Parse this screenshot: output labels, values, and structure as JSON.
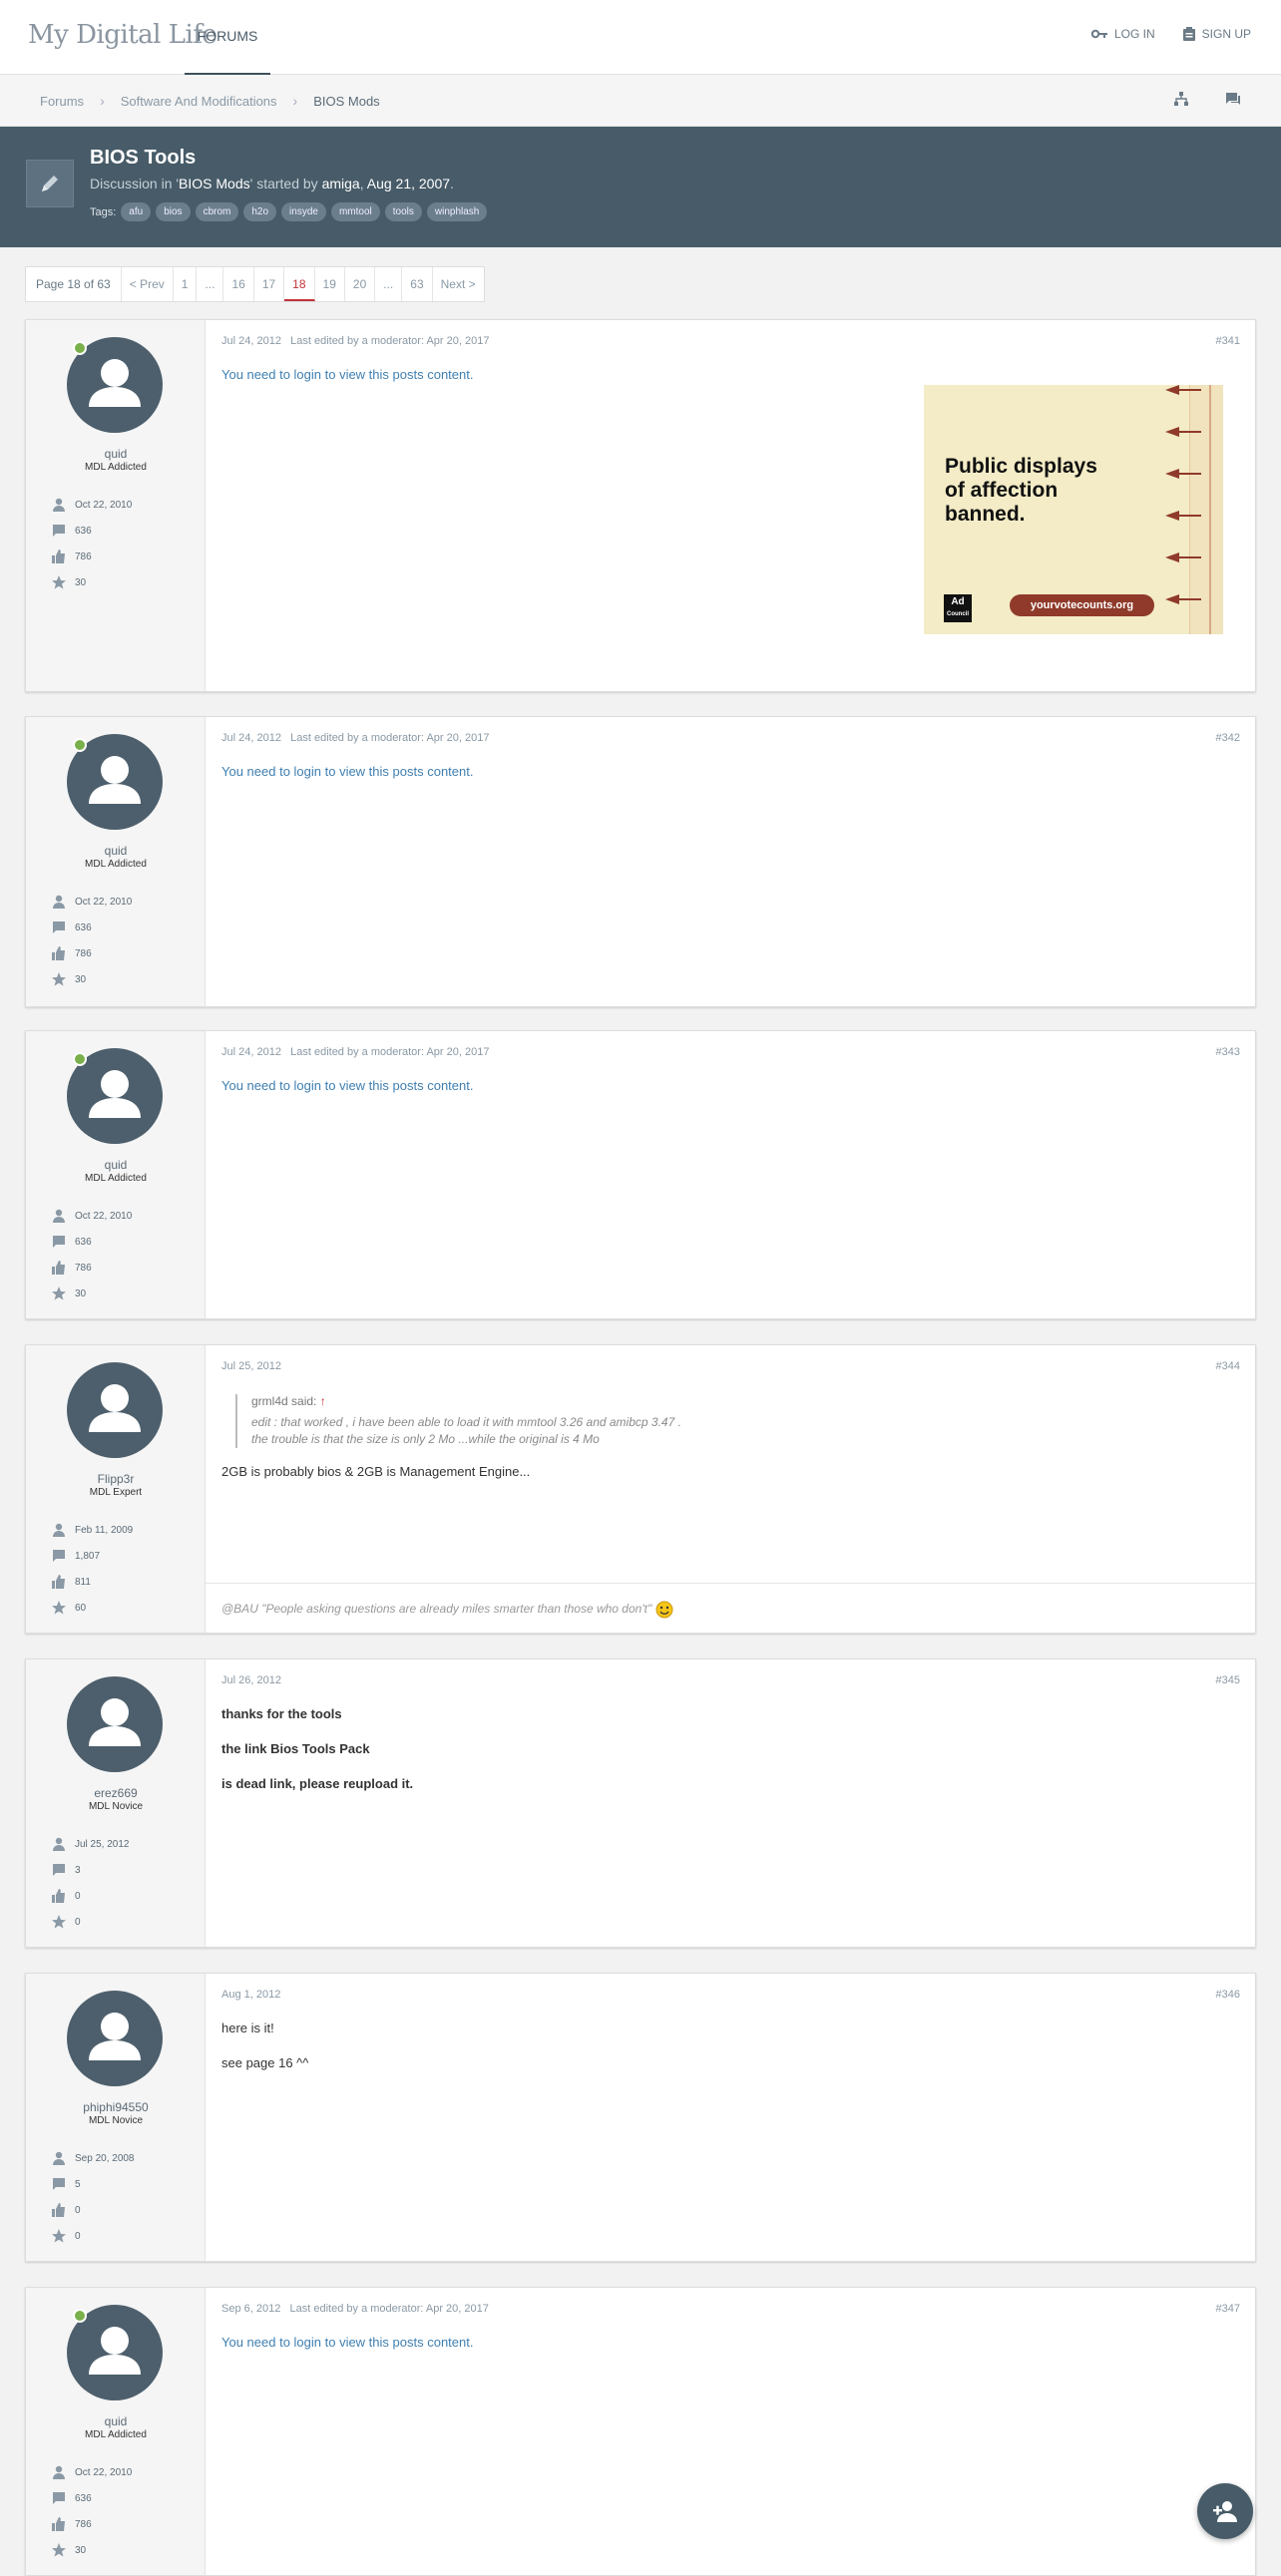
{
  "header": {
    "logo_main": "My Digital Life",
    "nav_forums": "FORUMS",
    "login": "LOG IN",
    "signup": "SIGN UP"
  },
  "breadcrumb": [
    "Forums",
    "Software And Modifications",
    "BIOS Mods"
  ],
  "thread": {
    "title": "BIOS Tools",
    "discussion_prefix": "Discussion in '",
    "forum": "BIOS Mods",
    "started_by": "' started by ",
    "author": "amiga",
    "date": "Aug 21, 2007",
    "tags_label": "Tags:",
    "tags": [
      "afu",
      "bios",
      "cbrom",
      "h2o",
      "insyde",
      "mmtool",
      "tools",
      "winphlash"
    ]
  },
  "pager": {
    "label": "Page 18 of 63",
    "prev": "< Prev",
    "pages": [
      "1",
      "...",
      "16",
      "17",
      "18",
      "19",
      "20",
      "...",
      "63"
    ],
    "active": "18",
    "next": "Next >"
  },
  "posts": [
    {
      "user": "quid",
      "rank": "MDL Addicted",
      "joined": "Oct 22, 2010",
      "messages": "636",
      "likes": "786",
      "points": "30",
      "date": "Jul 24, 2012",
      "edited": "Last edited by a moderator: Apr 20, 2017",
      "num": "#341",
      "text": "You need to login to view this posts content."
    },
    {
      "user": "quid",
      "rank": "MDL Addicted",
      "joined": "Oct 22, 2010",
      "messages": "636",
      "likes": "786",
      "points": "30",
      "date": "Jul 24, 2012",
      "edited": "Last edited by a moderator: Apr 20, 2017",
      "num": "#342",
      "text": "You need to login to view this posts content."
    },
    {
      "user": "quid",
      "rank": "MDL Addicted",
      "joined": "Oct 22, 2010",
      "messages": "636",
      "likes": "786",
      "points": "30",
      "date": "Jul 24, 2012",
      "edited": "Last edited by a moderator: Apr 20, 2017",
      "num": "#343",
      "text": "You need to login to view this posts content."
    },
    {
      "user": "Flipp3r",
      "rank": "MDL Expert",
      "joined": "Feb 11, 2009",
      "messages": "1,807",
      "likes": "811",
      "points": "60",
      "date": "Jul 25, 2012",
      "num": "#344",
      "quote_attr": "grml4d said:",
      "quote_line1": "edit : that worked , i have been able to load it with mmtool 3.26 and amibcp 3.47 .",
      "quote_line2": "the trouble is that the size is only 2 Mo ...while the original is 4 Mo",
      "text": "2GB is probably bios & 2GB is Management Engine...",
      "signature": "@BAU \"People asking questions are already miles smarter than those who don't\""
    },
    {
      "user": "erez669",
      "rank": "MDL Novice",
      "joined": "Jul 25, 2012",
      "messages": "3",
      "likes": "0",
      "points": "0",
      "date": "Jul 26, 2012",
      "num": "#345",
      "line1": "thanks for the tools",
      "line2": "the link Bios Tools Pack",
      "line3": "is dead link, please reupload it."
    },
    {
      "user": "phiphi94550",
      "rank": "MDL Novice",
      "joined": "Sep 20, 2008",
      "messages": "5",
      "likes": "0",
      "points": "0",
      "date": "Aug 1, 2012",
      "num": "#346",
      "line1": "here is it!",
      "line2": "see page 16 ^^"
    },
    {
      "user": "quid",
      "rank": "MDL Addicted",
      "joined": "Oct 22, 2010",
      "messages": "636",
      "likes": "786",
      "points": "30",
      "date": "Sep 6, 2012",
      "edited": "Last edited by a moderator: Apr 20, 2017",
      "num": "#347",
      "text": "You need to login to view this posts content."
    }
  ],
  "ad": {
    "line1": "Public displays",
    "line2": "of affection",
    "line3": "banned.",
    "badge_line1": "Ad",
    "badge_line2": "Council",
    "url": "yourvotecounts.org"
  },
  "icons": [
    "key-icon",
    "clipboard-icon",
    "sitemap-icon",
    "chat-icon",
    "pencil-icon",
    "user-icon",
    "message-icon",
    "thumbs-up-icon",
    "star-icon",
    "add-user-icon"
  ],
  "colors": {
    "accent": "#475b68",
    "active_page": "#c2333a",
    "link": "#3f7fb1",
    "online": "#7ab04b"
  }
}
